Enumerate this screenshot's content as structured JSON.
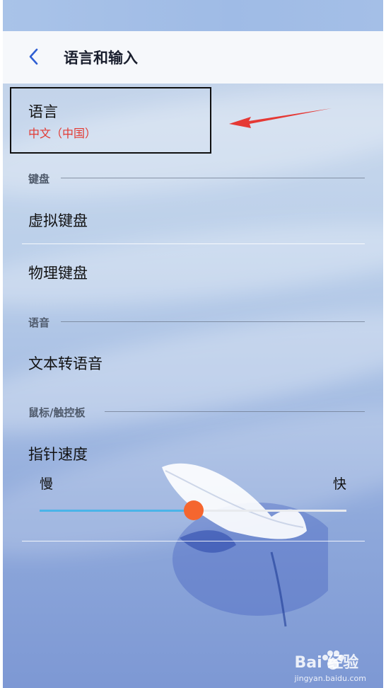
{
  "header": {
    "title": "语言和输入"
  },
  "language": {
    "label": "语言",
    "value": "中文（中国）"
  },
  "sections": {
    "keyboard": "键盘",
    "speech": "语音",
    "pointer": "鼠标/触控板"
  },
  "items": {
    "virtual_keyboard": "虚拟键盘",
    "physical_keyboard": "物理键盘",
    "tts": "文本转语音",
    "pointer_speed": "指针速度"
  },
  "slider": {
    "min_label": "慢",
    "max_label": "快",
    "value_fraction": 0.5
  },
  "colors": {
    "accent": "#4ab4e8",
    "thumb": "#f5662f",
    "highlight_text": "#e23a33",
    "annotation_arrow": "#e53935"
  },
  "watermark": {
    "brand": "Bai 经验",
    "url": "jingyan.baidu.com"
  }
}
